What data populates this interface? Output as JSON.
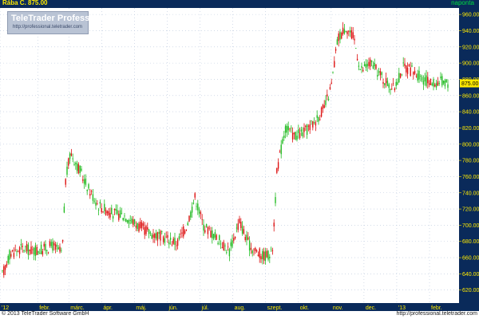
{
  "header": {
    "title": "Rába C. 875.00",
    "frequency": "naponta"
  },
  "logo": {
    "brand": "TeleTrader Professional",
    "url": "http://professional.teletrader.com"
  },
  "footer": {
    "copyright": "© 2013 TeleTrader Software GmbH",
    "url": "http://professional.teletrader.com"
  },
  "colors": {
    "background": "#ffffff",
    "header_bg": "#0a2a5a",
    "title": "#ffea00",
    "axis_bg": "#0a2a5a",
    "axis_text": "#ffea00",
    "up": "#22bb22",
    "down": "#dd1111",
    "last_price_bg": "#ffe800",
    "grid": "#b8c6dc"
  },
  "chart_data": {
    "type": "candlestick",
    "instrument": "Rába",
    "last_price": 875.0,
    "last_price_label": "875.00",
    "y_ticks": [
      620,
      640,
      660,
      680,
      700,
      720,
      740,
      760,
      780,
      800,
      820,
      840,
      860,
      880,
      900,
      920,
      940,
      960
    ],
    "y_tick_labels": [
      "620.00",
      "640.00",
      "660.00",
      "680.00",
      "700.00",
      "720.00",
      "740.00",
      "760.00",
      "780.00",
      "800.00",
      "820.00",
      "840.00",
      "860.00",
      "880.00",
      "900.00",
      "920.00",
      "940.00",
      "960.00"
    ],
    "ylim": [
      604,
      968
    ],
    "x_labels": [
      "'12",
      "febr.",
      "márc.",
      "ápr.",
      "máj.",
      "jún.",
      "júl.",
      "aug.",
      "szept.",
      "okt.",
      "nov.",
      "dec.",
      "'13",
      "febr."
    ],
    "x_label_positions": [
      0.0,
      1.15,
      2.1,
      3.1,
      4.1,
      5.1,
      6.1,
      7.1,
      8.1,
      9.1,
      10.1,
      11.1,
      12.1,
      13.1
    ],
    "xlim": [
      0,
      14.0
    ],
    "price_path": [
      [
        0.0,
        630
      ],
      [
        0.3,
        665
      ],
      [
        0.7,
        672
      ],
      [
        1.0,
        668
      ],
      [
        1.3,
        670
      ],
      [
        1.6,
        675
      ],
      [
        1.9,
        665
      ],
      [
        2.0,
        755
      ],
      [
        2.15,
        790
      ],
      [
        2.4,
        770
      ],
      [
        2.7,
        745
      ],
      [
        3.0,
        725
      ],
      [
        3.4,
        715
      ],
      [
        3.8,
        712
      ],
      [
        4.2,
        700
      ],
      [
        4.6,
        690
      ],
      [
        5.0,
        685
      ],
      [
        5.4,
        678
      ],
      [
        5.7,
        700
      ],
      [
        5.95,
        735
      ],
      [
        6.2,
        700
      ],
      [
        6.6,
        685
      ],
      [
        7.0,
        668
      ],
      [
        7.3,
        705
      ],
      [
        7.6,
        675
      ],
      [
        8.0,
        662
      ],
      [
        8.3,
        665
      ],
      [
        8.45,
        768
      ],
      [
        8.7,
        820
      ],
      [
        9.0,
        810
      ],
      [
        9.3,
        815
      ],
      [
        9.6,
        828
      ],
      [
        9.9,
        845
      ],
      [
        10.1,
        870
      ],
      [
        10.3,
        930
      ],
      [
        10.55,
        945
      ],
      [
        10.8,
        930
      ],
      [
        11.0,
        890
      ],
      [
        11.3,
        900
      ],
      [
        11.7,
        880
      ],
      [
        12.0,
        868
      ],
      [
        12.3,
        895
      ],
      [
        12.6,
        890
      ],
      [
        12.9,
        880
      ],
      [
        13.2,
        875
      ],
      [
        13.5,
        878
      ],
      [
        13.7,
        875
      ]
    ]
  }
}
